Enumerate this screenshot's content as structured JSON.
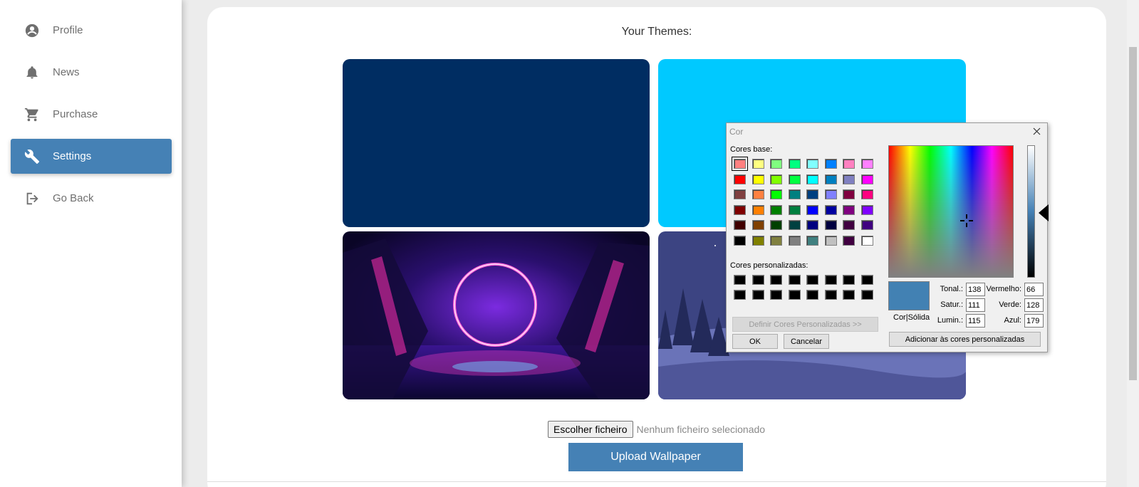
{
  "sidebar": {
    "items": [
      {
        "label": "Profile",
        "icon": "account-circle-icon"
      },
      {
        "label": "News",
        "icon": "bell-icon"
      },
      {
        "label": "Purchase",
        "icon": "cart-icon"
      },
      {
        "label": "Settings",
        "icon": "wrench-icon",
        "active": true
      },
      {
        "label": "Go Back",
        "icon": "logout-icon"
      }
    ]
  },
  "main": {
    "title": "Your Themes:",
    "themes": [
      {
        "kind": "solid",
        "color": "#002d62"
      },
      {
        "kind": "solid",
        "color": "#00c9ff"
      },
      {
        "kind": "image",
        "description_icon": "neon-ring-wallpaper"
      },
      {
        "kind": "image",
        "description_icon": "night-forest-wallpaper"
      }
    ],
    "file_button": "Escolher ficheiro",
    "file_status": "Nenhum ficheiro selecionado",
    "upload_button": "Upload Wallpaper"
  },
  "color_dialog": {
    "title": "Cor",
    "base_label": "Cores base:",
    "custom_label": "Cores personalizadas:",
    "define_button": "Definir Cores Personalizadas >>",
    "ok": "OK",
    "cancel": "Cancelar",
    "add_button": "Adicionar às cores personalizadas",
    "preview_label": "Cor|Sólida",
    "fields": {
      "tonal_label": "Tonal.:",
      "tonal": "138",
      "satur_label": "Satur.:",
      "satur": "111",
      "lumin_label": "Lumin.:",
      "lumin": "115",
      "red_label": "Vermelho:",
      "red": "66",
      "green_label": "Verde:",
      "green": "128",
      "blue_label": "Azul:",
      "blue": "179"
    },
    "base_colors": [
      [
        "#ff8080",
        "#ffff80",
        "#80ff80",
        "#00ff80",
        "#80ffff",
        "#0080ff",
        "#ff80c0",
        "#ff80ff"
      ],
      [
        "#ff0000",
        "#ffff00",
        "#80ff00",
        "#00ff40",
        "#00ffff",
        "#0080c0",
        "#8080c0",
        "#ff00ff"
      ],
      [
        "#804040",
        "#ff8040",
        "#00ff00",
        "#008080",
        "#004080",
        "#8080ff",
        "#800040",
        "#ff0080"
      ],
      [
        "#800000",
        "#ff8000",
        "#008000",
        "#008040",
        "#0000ff",
        "#0000a0",
        "#800080",
        "#8000ff"
      ],
      [
        "#400000",
        "#804000",
        "#004000",
        "#004040",
        "#000080",
        "#000040",
        "#400040",
        "#400080"
      ],
      [
        "#000000",
        "#808000",
        "#808040",
        "#808080",
        "#408080",
        "#c0c0c0",
        "#400040",
        "#ffffff"
      ]
    ],
    "custom_colors": [
      [
        "#000000",
        "#000000",
        "#000000",
        "#000000",
        "#000000",
        "#000000",
        "#000000",
        "#000000"
      ],
      [
        "#000000",
        "#000000",
        "#000000",
        "#000000",
        "#000000",
        "#000000",
        "#000000",
        "#000000"
      ]
    ],
    "selected_preview_color": "#4281b3"
  }
}
